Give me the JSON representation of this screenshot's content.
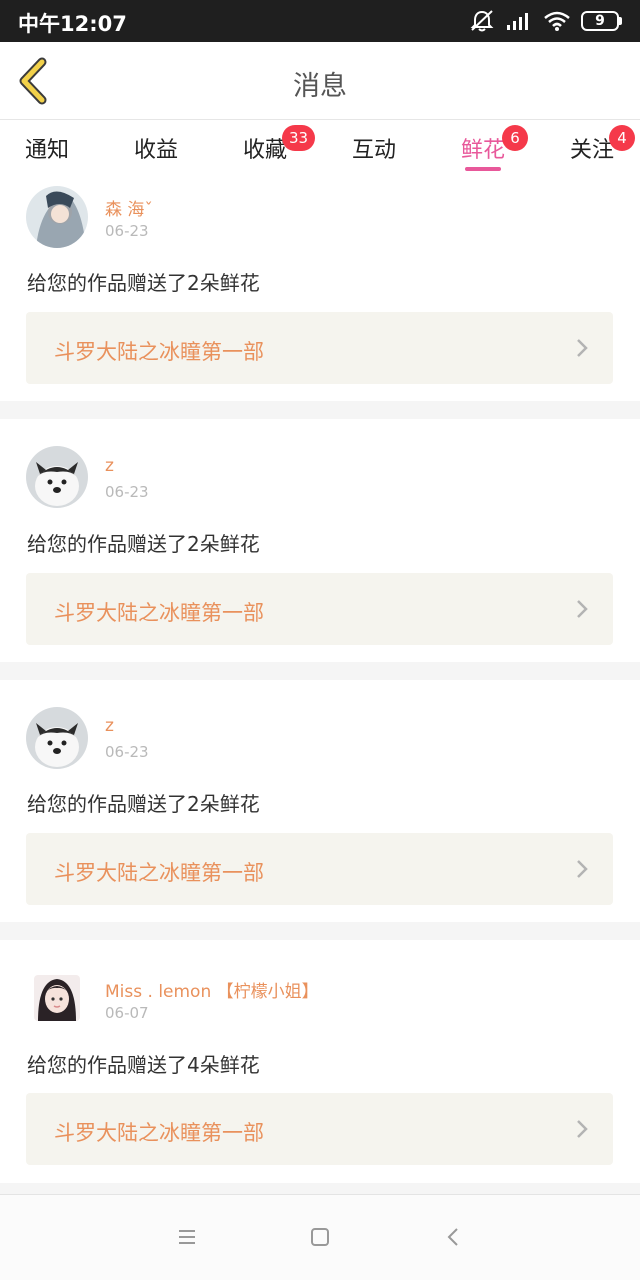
{
  "status_bar": {
    "time": "中午12:07",
    "battery": "9"
  },
  "header": {
    "title": "消息"
  },
  "tabs": [
    {
      "label": "通知",
      "badge": ""
    },
    {
      "label": "收益",
      "badge": ""
    },
    {
      "label": "收藏",
      "badge": "33"
    },
    {
      "label": "互动",
      "badge": ""
    },
    {
      "label": "鲜花",
      "badge": "6",
      "active": true
    },
    {
      "label": "关注",
      "badge": "4"
    }
  ],
  "messages": [
    {
      "user": "森 海ˇ",
      "date": "06-23",
      "text": "给您的作品赠送了2朵鲜花",
      "work": "斗罗大陆之冰瞳第一部"
    },
    {
      "user": "z",
      "date": "06-23",
      "text": "给您的作品赠送了2朵鲜花",
      "work": "斗罗大陆之冰瞳第一部"
    },
    {
      "user": "z",
      "date": "06-23",
      "text": "给您的作品赠送了2朵鲜花",
      "work": "斗罗大陆之冰瞳第一部"
    },
    {
      "user": "Miss . lemon 【柠檬小姐】",
      "date": "06-07",
      "text": "给您的作品赠送了4朵鲜花",
      "work": "斗罗大陆之冰瞳第一部"
    }
  ],
  "colors": {
    "accent": "#e8589a",
    "username": "#e9915c",
    "badge": "#f5394a"
  }
}
